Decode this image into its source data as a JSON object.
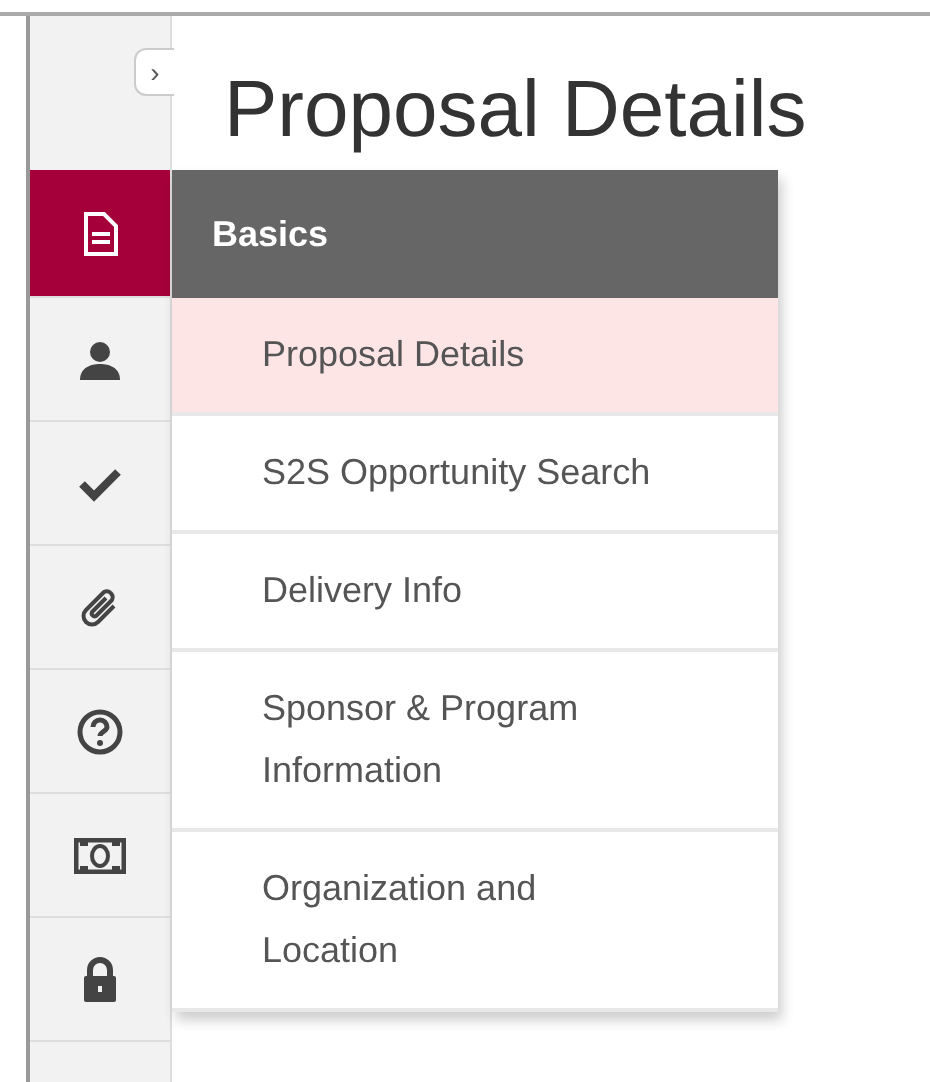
{
  "toggle": {
    "label": "›"
  },
  "title": "Proposal Details",
  "sidebar": {
    "items": [
      {
        "selected": true
      },
      {
        "selected": false
      },
      {
        "selected": false
      },
      {
        "selected": false
      },
      {
        "selected": false
      },
      {
        "selected": false
      },
      {
        "selected": false
      }
    ]
  },
  "menu": {
    "header": "Basics",
    "items": [
      {
        "label": "Proposal Details",
        "selected": true
      },
      {
        "label": "S2S Opportunity Search",
        "selected": false
      },
      {
        "label": "Delivery Info",
        "selected": false
      },
      {
        "label": "Sponsor & Program Information",
        "selected": false
      },
      {
        "label": "Organization and Location",
        "selected": false
      }
    ]
  }
}
